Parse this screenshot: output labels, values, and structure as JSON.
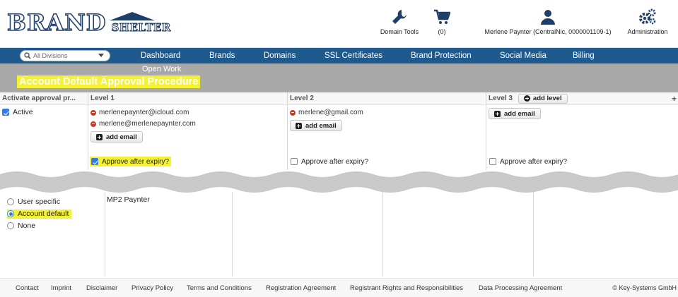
{
  "header": {
    "logo_brand": "BRAND",
    "logo_shelter": "SHELTER",
    "domain_tools": "Domain Tools",
    "cart_count": "(0)",
    "user": "Merlene Paynter (CentralNic, 0000001109-1)",
    "administration": "Administration"
  },
  "nav": {
    "division_placeholder": "All Divisions",
    "items": [
      "Dashboard",
      "Brands",
      "Domains",
      "SSL Certificates",
      "Brand Protection",
      "Social Media",
      "Billing"
    ],
    "sub_item": "Open Work"
  },
  "page": {
    "title": "Account Default Approval Procedure"
  },
  "approval": {
    "col0_header": "Activate approval pr...",
    "active_label": "Active",
    "active_checked": true,
    "level1": {
      "header": "Level 1",
      "emails": [
        "merlenepaynter@icloud.com",
        "merlene@merlenepaynter.com"
      ],
      "add_email": "add email",
      "expiry_label": "Approve after expiry?",
      "expiry_checked": true
    },
    "level2": {
      "header": "Level 2",
      "emails": [
        "merlene@gmail.com"
      ],
      "add_email": "add email",
      "expiry_label": "Approve after expiry?",
      "expiry_checked": false
    },
    "level3": {
      "header": "Level 3",
      "add_level": "add level",
      "add_email": "add email",
      "expiry_label": "Approve after expiry?",
      "expiry_checked": false
    }
  },
  "defaults": {
    "options": [
      "User specific",
      "Account default",
      "None"
    ],
    "selected": "Account default",
    "name": "MP2 Paynter"
  },
  "footer": {
    "links": [
      "Contact",
      "Imprint",
      "Disclaimer",
      "Privacy Policy",
      "Terms and Conditions",
      "Registration Agreement",
      "Registrant Rights and Responsibilities",
      "Data Processing Agreement"
    ],
    "copyright": "© Key-Systems GmbH"
  },
  "colors": {
    "nav_bg": "#1e5a8e",
    "title_band": "#aaa9a9",
    "highlight": "#f5f233",
    "accent": "#2f7ee8"
  }
}
